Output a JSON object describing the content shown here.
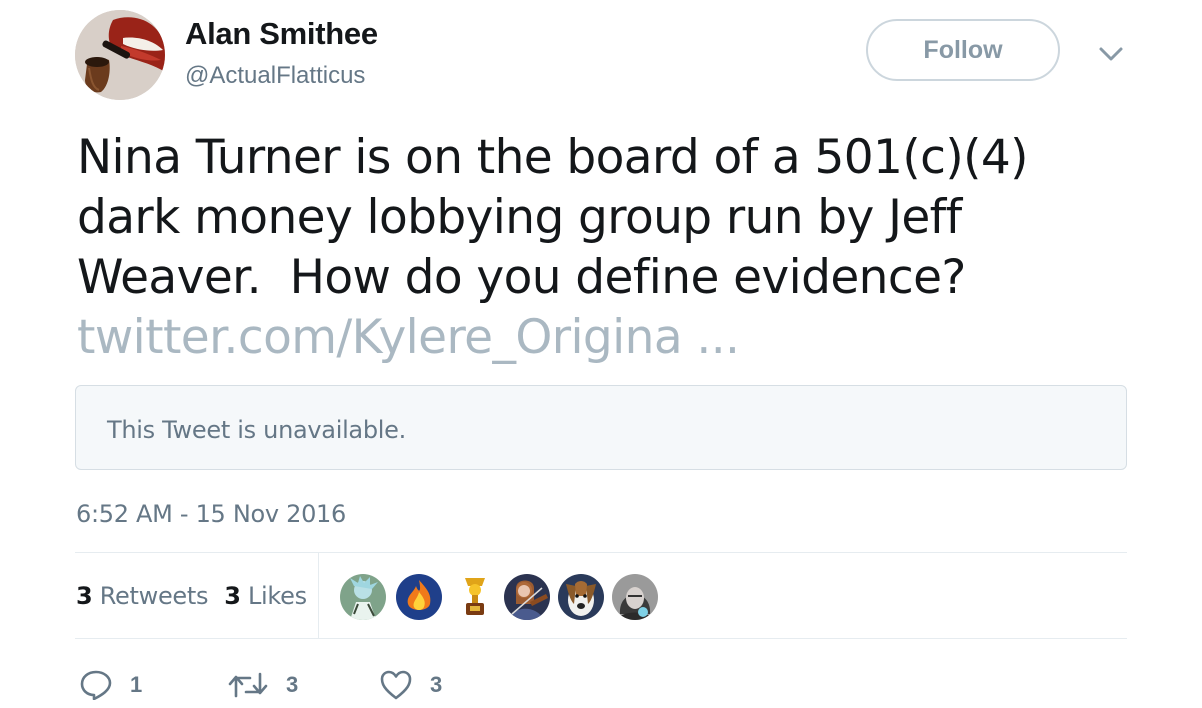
{
  "author": {
    "name": "Alan Smithee",
    "handle": "@ActualFlatticus",
    "avatar_icon": "pipe-smoking-mouth-avatar"
  },
  "header": {
    "follow_label": "Follow",
    "menu_icon": "chevron-down-icon"
  },
  "tweet": {
    "text_lines": [
      "Nina Turner is on the board of a 501(c)(4)",
      "dark money lobbying group run by Jeff",
      "Weaver.  How do you define evidence?"
    ],
    "link": "twitter.com/Kylere_Origina ..."
  },
  "quote": {
    "message": "This Tweet is unavailable."
  },
  "timestamp": "6:52 AM - 15 Nov 2016",
  "stats": {
    "retweets_count": "3",
    "retweets_label": "Retweets",
    "likes_count": "3",
    "likes_label": "Likes"
  },
  "likers": [
    "rick-avatar",
    "fire-avatar",
    "trophy-avatar",
    "violin-avatar",
    "dog-avatar",
    "woman-avatar"
  ],
  "actions": {
    "reply_count": "1",
    "retweet_count": "3",
    "like_count": "3"
  },
  "colors": {
    "text": "#14171a",
    "secondary": "#657786",
    "link_faded": "#aab8c2",
    "border": "#e6ecf0"
  }
}
